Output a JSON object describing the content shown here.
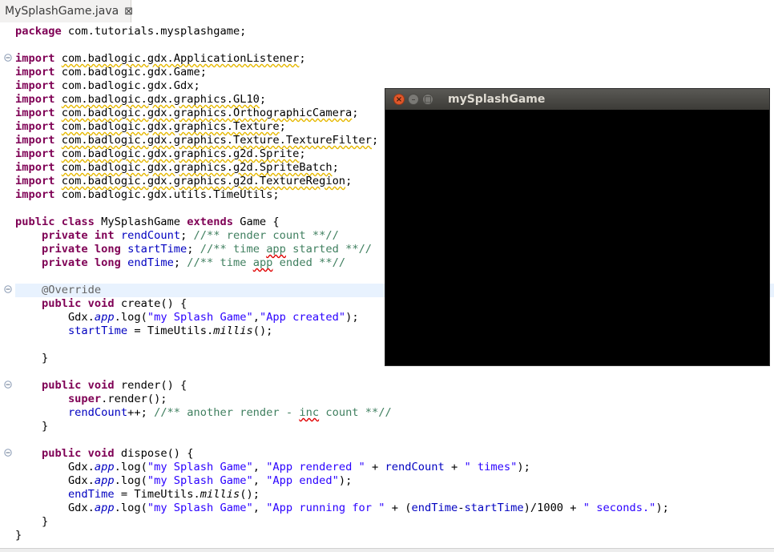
{
  "tab": {
    "title": "MySplashGame.java",
    "close_glyph": "⊠"
  },
  "code": {
    "package": {
      "kw": "package",
      "name": " com.tutorials.mysplashgame;"
    },
    "import_kw": "import",
    "imports": [
      {
        "name": "com.badlogic.gdx.ApplicationListener",
        "warn": true
      },
      {
        "name": "com.badlogic.gdx.Game",
        "warn": false
      },
      {
        "name": "com.badlogic.gdx.Gdx",
        "warn": false
      },
      {
        "name": "com.badlogic.gdx.graphics.GL10",
        "warn": true
      },
      {
        "name": "com.badlogic.gdx.graphics.OrthographicCamera",
        "warn": true
      },
      {
        "name": "com.badlogic.gdx.graphics.Texture",
        "warn": true
      },
      {
        "name": "com.badlogic.gdx.graphics.Texture.TextureFilter",
        "warn": true
      },
      {
        "name": "com.badlogic.gdx.graphics.g2d.Sprite",
        "warn": true
      },
      {
        "name": "com.badlogic.gdx.graphics.g2d.SpriteBatch",
        "warn": true
      },
      {
        "name": "com.badlogic.gdx.graphics.g2d.TextureRegion",
        "warn": true
      },
      {
        "name": "com.badlogic.gdx.utils.TimeUtils",
        "warn": false
      }
    ],
    "class_decl": {
      "kw1": "public",
      "kw2": "class",
      "name": " MySplashGame ",
      "kw3": "extends",
      "rest": " Game {"
    },
    "fields": [
      {
        "mod": "private",
        "type": "int",
        "name": "rendCount",
        "c1": "//** render count **//",
        "c2": "",
        "c3": ""
      },
      {
        "mod": "private",
        "type": "long",
        "name": "startTime",
        "c1": "//** time ",
        "c2": "app",
        "c3": " started **//"
      },
      {
        "mod": "private",
        "type": "long",
        "name": "endTime",
        "c1": "//** time ",
        "c2": "app",
        "c3": " ended **//"
      }
    ],
    "override": "@Override",
    "create": {
      "kw1": "public",
      "kw2": "void",
      "sig": " create() {",
      "l1_a": "Gdx.",
      "l1_app": "app",
      "l1_b": ".log(",
      "l1_s1": "\"my Splash Game\"",
      "l1_comma": ",",
      "l1_s2": "\"App created\"",
      "l1_end": ");",
      "l2_field": "startTime",
      "l2_a": " = TimeUtils.",
      "l2_m": "millis",
      "l2_end": "();"
    },
    "close_brace": "}",
    "render": {
      "kw1": "public",
      "kw2": "void",
      "sig": " render() {",
      "l1_kw": "super",
      "l1_rest": ".render();",
      "l2_field": "rendCount",
      "l2_rest": "++; ",
      "l2_c1": "//** another render - ",
      "l2_c2": "inc",
      "l2_c3": " count **//"
    },
    "dispose": {
      "kw1": "public",
      "kw2": "void",
      "sig": " dispose() {",
      "gdx": "Gdx.",
      "app": "app",
      "log": ".log(",
      "tag": "\"my Splash Game\"",
      "sep": ", ",
      "l1_s2": "\"App rendered \"",
      "l1_plus": " + ",
      "l1_field": "rendCount",
      "l1_s3": "\" times\"",
      "l1_end": ");",
      "l2_s2": "\"App ended\"",
      "l2_end": ");",
      "l3_field": "endTime",
      "l3_a": " = TimeUtils.",
      "l3_m": "millis",
      "l3_end": "();",
      "l4_s2": "\"App running for \"",
      "l4_a": " + (",
      "l4_f1": "endTime",
      "l4_dash": "-",
      "l4_f2": "startTime",
      "l4_b": ")/1000 + ",
      "l4_s3": "\" seconds.\"",
      "l4_end": ");"
    },
    "final_brace": "}"
  },
  "game_window": {
    "title": "mySplashGame",
    "close_glyph": "×",
    "min_glyph": "–",
    "max_glyph": "□"
  }
}
